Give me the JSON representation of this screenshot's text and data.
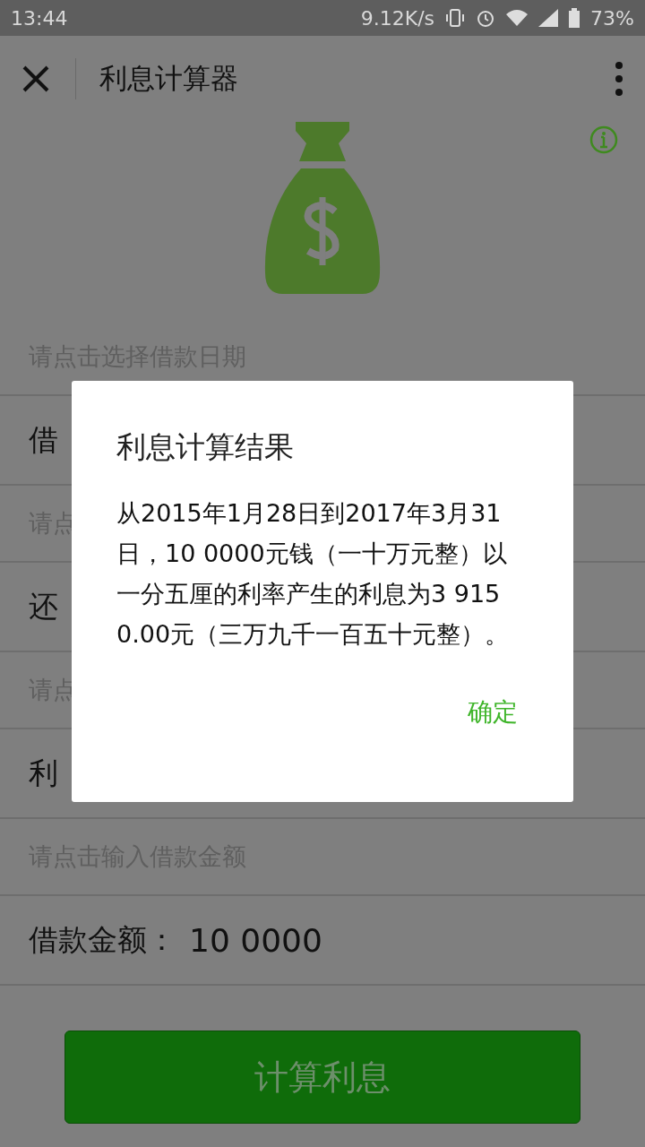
{
  "status_bar": {
    "time": "13:44",
    "speed": "9.12K/s",
    "battery": "73%"
  },
  "header": {
    "title": "利息计算器"
  },
  "rows": [
    {
      "kind": "hint",
      "text": "请点击选择借款日期"
    },
    {
      "kind": "field",
      "label": "借"
    },
    {
      "kind": "hint",
      "text": "请点"
    },
    {
      "kind": "field",
      "label": "还"
    },
    {
      "kind": "hint",
      "text": "请点"
    },
    {
      "kind": "field",
      "label": "利"
    },
    {
      "kind": "hint",
      "text": "请点击输入借款金额"
    },
    {
      "kind": "field",
      "label": "借款金额：",
      "value": "10 0000"
    }
  ],
  "calculate_button": "计算利息",
  "dialog": {
    "title": "利息计算结果",
    "message": "从2015年1月28日到2017年3月31日，10 0000元钱（一十万元整）以一分五厘的利率产生的利息为3 9150.00元（三万九千一百五十元整）。",
    "confirm": "确定"
  }
}
